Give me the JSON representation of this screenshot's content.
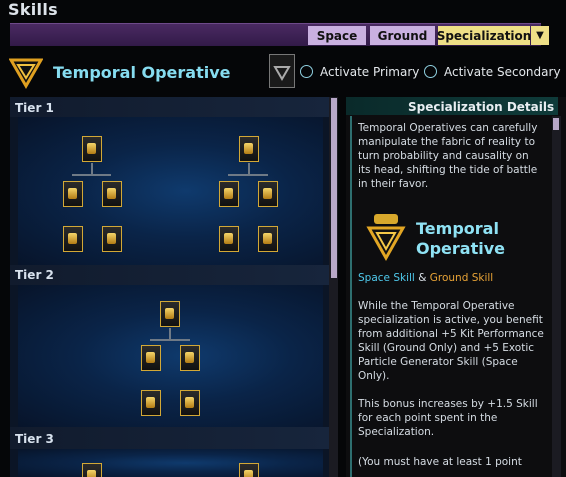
{
  "header": {
    "title": "Skills"
  },
  "tabs": [
    {
      "label": "Space",
      "active": false
    },
    {
      "label": "Ground",
      "active": false
    },
    {
      "label": "Specialization",
      "active": true
    }
  ],
  "spec": {
    "title": "Temporal Operative",
    "activate_primary": "Activate Primary",
    "activate_secondary": "Activate Secondary"
  },
  "tree": {
    "tier1": "Tier 1",
    "tier2": "Tier 2",
    "tier3": "Tier 3"
  },
  "details": {
    "header": "Specialization Details",
    "intro": "Temporal Operatives can carefully manipulate the fabric of reality to turn probability and causality on its head, shifting the tide of battle in their favor.",
    "name": "Temporal Operative",
    "space_skill": "Space Skill",
    "amp": "&",
    "ground_skill": "Ground Skill",
    "body": "While the Temporal Operative specialization is active, you benefit from additional +5 Kit Performance Skill (Ground Only) and +5 Exotic Particle Generator Skill (Space Only).",
    "bonus": "This bonus increases by +1.5 Skill for each point spent in the Specialization.",
    "note": "(You must have at least 1 point"
  },
  "colors": {
    "accent_cyan": "#86dcf0",
    "space_skill": "#4fc9ec",
    "ground_skill": "#e8a336",
    "active_tab": "#eedf86",
    "tab": "#c9b0e0"
  }
}
